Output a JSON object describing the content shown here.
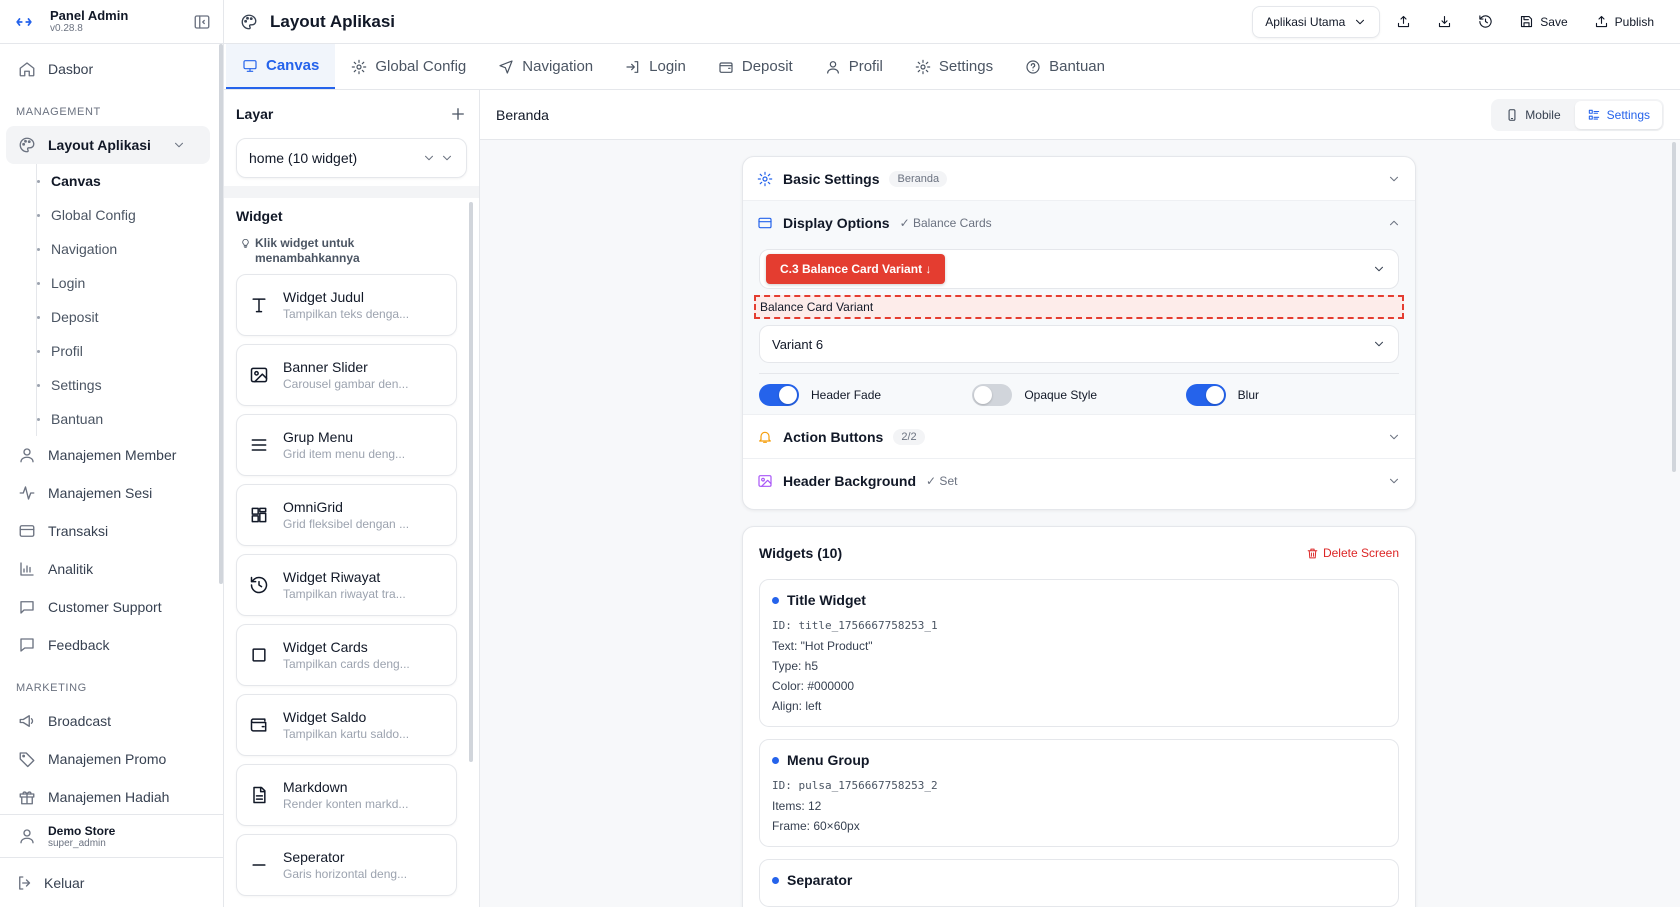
{
  "colors": {
    "accent": "#2563eb",
    "danger": "#dc2626",
    "badge_red": "#e43d30"
  },
  "brand": {
    "title": "Panel Admin",
    "version": "v0.28.8"
  },
  "sidebar": {
    "top": [
      {
        "label": "Dasbor",
        "icon": "home-icon"
      }
    ],
    "management_label": "MANAGEMENT",
    "active_group": "Layout Aplikasi",
    "sub_items": [
      "Canvas",
      "Global Config",
      "Navigation",
      "Login",
      "Deposit",
      "Profil",
      "Settings",
      "Bantuan"
    ],
    "management": [
      {
        "label": "Manajemen Member",
        "icon": "user-icon"
      },
      {
        "label": "Manajemen Sesi",
        "icon": "activity-icon"
      },
      {
        "label": "Transaksi",
        "icon": "credit-card-icon"
      },
      {
        "label": "Analitik",
        "icon": "bar-chart-icon"
      },
      {
        "label": "Customer Support",
        "icon": "message-icon"
      },
      {
        "label": "Feedback",
        "icon": "message-square-icon"
      }
    ],
    "marketing_label": "MARKETING",
    "marketing": [
      {
        "label": "Broadcast",
        "icon": "megaphone-icon"
      },
      {
        "label": "Manajemen Promo",
        "icon": "tag-icon"
      },
      {
        "label": "Manajemen Hadiah",
        "icon": "gift-icon"
      }
    ],
    "user": {
      "name": "Demo Store",
      "role": "super_admin"
    },
    "logout": "Keluar"
  },
  "header": {
    "title": "Layout Aplikasi",
    "app_select": "Aplikasi Utama",
    "save": "Save",
    "publish": "Publish"
  },
  "tabs": [
    {
      "label": "Canvas",
      "icon": "monitor-icon",
      "active": true
    },
    {
      "label": "Global Config",
      "icon": "gear-icon"
    },
    {
      "label": "Navigation",
      "icon": "navigation-icon"
    },
    {
      "label": "Login",
      "icon": "login-icon"
    },
    {
      "label": "Deposit",
      "icon": "wallet-icon"
    },
    {
      "label": "Profil",
      "icon": "user-icon"
    },
    {
      "label": "Settings",
      "icon": "gear-icon"
    },
    {
      "label": "Bantuan",
      "icon": "help-circle-icon"
    }
  ],
  "layers": {
    "title": "Layar",
    "screen_select": "home (10 widget)",
    "widget_title": "Widget",
    "widget_hint": "Klik widget untuk menambahkannya",
    "widgets": [
      {
        "title": "Widget Judul",
        "desc": "Tampilkan teks denga...",
        "icon": "type-icon"
      },
      {
        "title": "Banner Slider",
        "desc": "Carousel gambar den...",
        "icon": "image-icon"
      },
      {
        "title": "Grup Menu",
        "desc": "Grid item menu deng...",
        "icon": "menu-icon"
      },
      {
        "title": "OmniGrid",
        "desc": "Grid fleksibel dengan ...",
        "icon": "grid-icon"
      },
      {
        "title": "Widget Riwayat",
        "desc": "Tampilkan riwayat tra...",
        "icon": "history-icon"
      },
      {
        "title": "Widget Cards",
        "desc": "Tampilkan cards deng...",
        "icon": "square-icon"
      },
      {
        "title": "Widget Saldo",
        "desc": "Tampilkan kartu saldo...",
        "icon": "wallet-icon"
      },
      {
        "title": "Markdown",
        "desc": "Render konten markd...",
        "icon": "file-text-icon"
      },
      {
        "title": "Seperator",
        "desc": "Garis horizontal deng...",
        "icon": "minus-icon"
      }
    ]
  },
  "main": {
    "title": "Beranda",
    "view_mobile": "Mobile",
    "view_settings": "Settings",
    "basic": {
      "title": "Basic Settings",
      "pill": "Beranda"
    },
    "display": {
      "title": "Display Options",
      "note": "✓ Balance Cards",
      "badge": "C.3 Balance Card Variant ↓",
      "field_label": "Balance Card Variant",
      "variant": "Variant 6",
      "toggles": [
        {
          "label": "Header Fade",
          "on": true
        },
        {
          "label": "Opaque Style",
          "on": false
        },
        {
          "label": "Blur",
          "on": true
        }
      ]
    },
    "action": {
      "title": "Action Buttons",
      "pill": "2/2"
    },
    "background": {
      "title": "Header Background",
      "note": "✓ Set"
    },
    "widgets": {
      "title": "Widgets (10)",
      "delete": "Delete Screen",
      "items": [
        {
          "title": "Title Widget",
          "lines": [
            "ID: title_1756667758253_1",
            "Text: \"Hot Product\"",
            "Type: h5",
            "Color: #000000",
            "Align: left"
          ]
        },
        {
          "title": "Menu Group",
          "lines": [
            "ID: pulsa_1756667758253_2",
            "Items: 12",
            "Frame: 60×60px"
          ]
        },
        {
          "title": "Separator",
          "lines": []
        }
      ]
    }
  }
}
